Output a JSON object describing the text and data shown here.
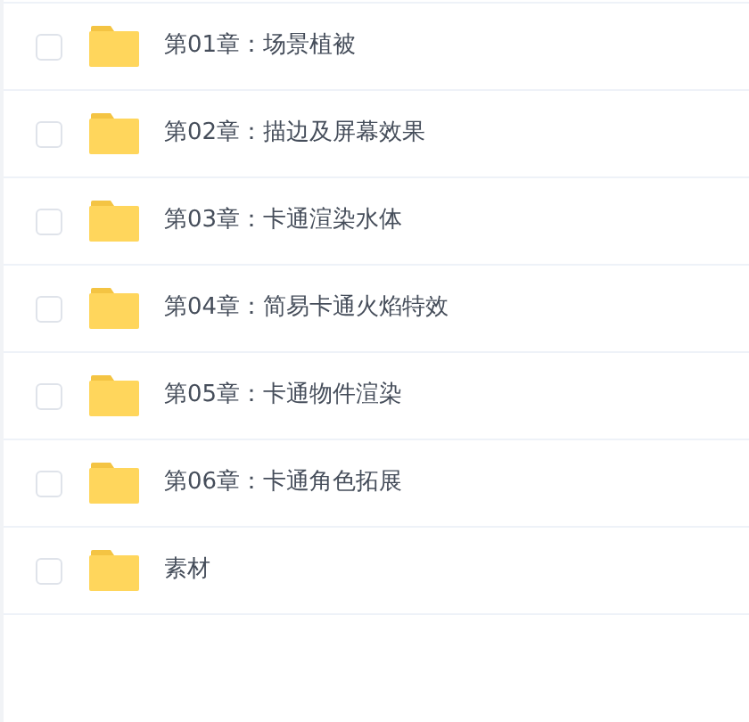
{
  "files": [
    {
      "name": "第01章：场景植被",
      "checked": false
    },
    {
      "name": "第02章：描边及屏幕效果",
      "checked": false
    },
    {
      "name": "第03章：卡通渲染水体",
      "checked": false
    },
    {
      "name": "第04章：简易卡通火焰特效",
      "checked": false
    },
    {
      "name": "第05章：卡通物件渲染",
      "checked": false
    },
    {
      "name": "第06章：卡通角色拓展",
      "checked": false
    },
    {
      "name": "素材",
      "checked": false
    }
  ]
}
